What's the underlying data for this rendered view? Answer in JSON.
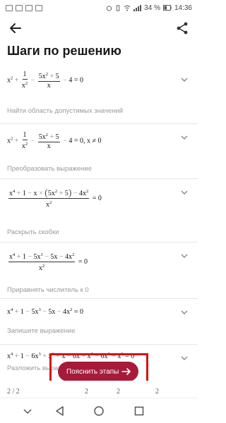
{
  "status": {
    "battery": "34 %",
    "time": "14:36"
  },
  "header": {
    "title": "Шаги по решению"
  },
  "steps": [
    {
      "description": "Найти область допустимых значений"
    },
    {
      "description": "Преобразовать выражение"
    },
    {
      "description": "Раскрыть скобки"
    },
    {
      "description": "Приравнять числитель к 0"
    },
    {
      "description": "Запишите выражение"
    },
    {
      "description": "Разложить выражение"
    }
  ],
  "explain_button": {
    "label": "Пояснить этапы"
  },
  "colors": {
    "accent": "#a61b3a",
    "highlight_frame": "#d21515",
    "muted_text": "#9a9a9a"
  }
}
